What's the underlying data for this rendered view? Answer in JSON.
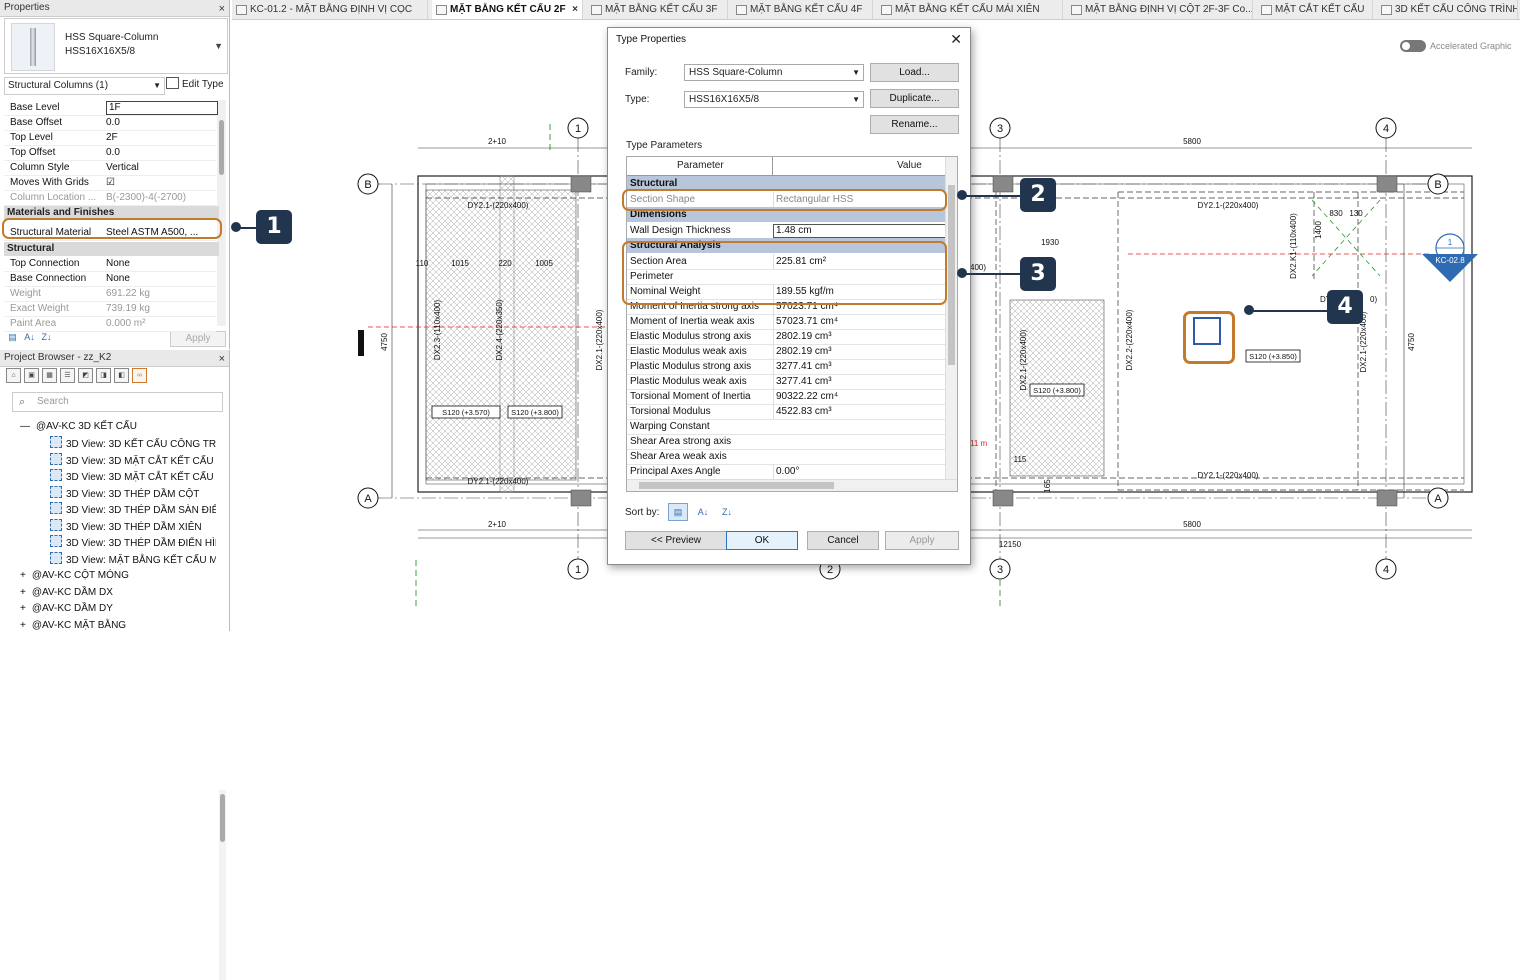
{
  "properties_panel": {
    "title": "Properties",
    "close_glyph": "×",
    "type_family": "HSS Square-Column",
    "type_name": "HSS16X16X5/8",
    "category_selector": "Structural Columns (1)",
    "edit_type_label": "Edit Type",
    "rows_constraints": [
      {
        "label": "Base Level",
        "value": "1F"
      },
      {
        "label": "Base Offset",
        "value": "0.0"
      },
      {
        "label": "Top Level",
        "value": "2F"
      },
      {
        "label": "Top Offset",
        "value": "0.0"
      },
      {
        "label": "Column Style",
        "value": "Vertical"
      },
      {
        "label": "Moves With Grids",
        "value": "☑"
      },
      {
        "label": "Column Location ...",
        "value": "B(-2300)-4(-2700)"
      }
    ],
    "section_materials": "Materials and Finishes",
    "structural_material": {
      "label": "Structural Material",
      "value": "Steel ASTM A500, ..."
    },
    "section_structural": "Structural",
    "rows_structural": [
      {
        "label": "Top Connection",
        "value": "None"
      },
      {
        "label": "Base Connection",
        "value": "None"
      },
      {
        "label": "Weight",
        "value": "691.22 kg"
      },
      {
        "label": "Exact Weight",
        "value": "739.19 kg"
      },
      {
        "label": "Paint Area",
        "value": "0.000 m²"
      }
    ],
    "apply_label": "Apply"
  },
  "project_browser": {
    "title": "Project Browser - zz_K2",
    "close_glyph": "×",
    "search_placeholder": "Search",
    "group_open": "@AV-KC 3D KẾT CẤU",
    "views": [
      "3D View: 3D KẾT CẤU CÔNG TRÌN",
      "3D View: 3D MẶT CẮT KẾT CẤU 1",
      "3D View: 3D MẶT CẮT KẾT CẤU 2",
      "3D View: 3D THÉP DẦM CỘT",
      "3D View: 3D THÉP DẦM SÀN ĐIỂN",
      "3D View: 3D THÉP DẦM XIÊN",
      "3D View: 3D THÉP DẦM ĐIỂN HÌN",
      "3D View: MẶT BẰNG KẾT CẤU MÓ"
    ],
    "groups_closed": [
      "@AV-KC CỘT MÓNG",
      "@AV-KC DẦM DX",
      "@AV-KC DẦM DY",
      "@AV-KC MẶT BẰNG"
    ]
  },
  "tabs": [
    {
      "label": "KC-01.2 - MẶT BẰNG ĐỊNH VỊ CỌC",
      "active": false
    },
    {
      "label": "MẶT BẰNG KẾT CẤU 2F",
      "active": true
    },
    {
      "label": "MẶT BẰNG KẾT CẤU 3F",
      "active": false
    },
    {
      "label": "MẶT BẰNG KẾT CẤU 4F",
      "active": false
    },
    {
      "label": "MẶT BẰNG KẾT CẤU MÁI XIÊN",
      "active": false
    },
    {
      "label": "MẶT BẰNG ĐỊNH VỊ CỘT 2F-3F Co...",
      "active": false
    },
    {
      "label": "MẶT CẮT KẾT CẤU",
      "active": false
    },
    {
      "label": "3D KẾT CẤU CÔNG TRÌNH",
      "active": false
    }
  ],
  "accelerated_graphics": "Accelerated Graphic",
  "plan": {
    "grid_numbers": [
      "1",
      "2",
      "3",
      "4"
    ],
    "grid_letters": [
      "A",
      "B"
    ],
    "dims": {
      "d1": "2+10",
      "d2": "5800",
      "d3": "5800",
      "d4": "2+10",
      "d5": "12150",
      "left": "4750",
      "right": "4750",
      "d1930": "1930",
      "d1400": "1400",
      "d830": "830",
      "d130": "130",
      "d1015": "1015",
      "d220": "220",
      "d1005": "1005",
      "d115": "115",
      "d165": "165",
      "d110": "110"
    },
    "beams": [
      "DY2.1-(220x400)",
      "DY2.1-(220x400)",
      "DY2.1-(220x400)",
      "DY2.1-(220x400)",
      "DX2.3-(110x400)",
      "DX2.4-(220x350)",
      "DX2.1-(220x400)",
      "DX2.1-(220x400)",
      "DX2.2-(220x400)",
      "DX2.1-(220x400)",
      "DX2.K1-(110x400)",
      "DY..."
    ],
    "slabs": [
      "S120 (+3.570)",
      "S120 (+3.800)",
      "S120 (+3.800)",
      "S120 (+3.850)"
    ],
    "section_tag": {
      "num": "1",
      "ref": "KC-02.8"
    },
    "misc": {
      "red_note": "11 m",
      "partial_dim": "400)",
      "dy_suffix": "0)"
    }
  },
  "dialog": {
    "title": "Type Properties",
    "close_glyph": "✕",
    "family_label": "Family:",
    "family_value": "HSS Square-Column",
    "type_label": "Type:",
    "type_value": "HSS16X16X5/8",
    "load_label": "Load...",
    "duplicate_label": "Duplicate...",
    "rename_label": "Rename...",
    "type_parameters_label": "Type Parameters",
    "col_parameter": "Parameter",
    "col_value": "Value",
    "sec_structural": "Structural",
    "section_shape": {
      "label": "Section Shape",
      "value": "Rectangular HSS"
    },
    "sec_dimensions": "Dimensions",
    "wall_thickness": {
      "label": "Wall Design Thickness",
      "value": "1.48 cm"
    },
    "sec_analysis": "Structural Analysis",
    "analysis_rows": [
      {
        "label": "Section Area",
        "value": "225.81 cm²"
      },
      {
        "label": "Perimeter",
        "value": ""
      },
      {
        "label": "Nominal Weight",
        "value": "189.55 kgf/m"
      },
      {
        "label": "Moment of Inertia strong axis",
        "value": "57023.71 cm⁴"
      },
      {
        "label": "Moment of Inertia weak axis",
        "value": "57023.71 cm⁴"
      },
      {
        "label": "Elastic Modulus strong axis",
        "value": "2802.19 cm³"
      },
      {
        "label": "Elastic Modulus weak axis",
        "value": "2802.19 cm³"
      },
      {
        "label": "Plastic Modulus strong axis",
        "value": "3277.41 cm³"
      },
      {
        "label": "Plastic Modulus weak axis",
        "value": "3277.41 cm³"
      },
      {
        "label": "Torsional Moment of Inertia",
        "value": "90322.22 cm⁴"
      },
      {
        "label": "Torsional Modulus",
        "value": "4522.83 cm³"
      },
      {
        "label": "Warping Constant",
        "value": ""
      },
      {
        "label": "Shear Area strong axis",
        "value": ""
      },
      {
        "label": "Shear Area weak axis",
        "value": ""
      },
      {
        "label": "Principal Axes Angle",
        "value": "0.00°"
      }
    ],
    "sort_by_label": "Sort by:",
    "preview_label": "<< Preview",
    "ok_label": "OK",
    "cancel_label": "Cancel",
    "apply_label": "Apply"
  },
  "callouts": [
    "1",
    "2",
    "3",
    "4"
  ],
  "colors": {
    "accent_orange": "#c47a2c",
    "badge_navy": "#21354f",
    "section_blue": "#b7c6da",
    "tag_blue": "#2f6bb3"
  }
}
